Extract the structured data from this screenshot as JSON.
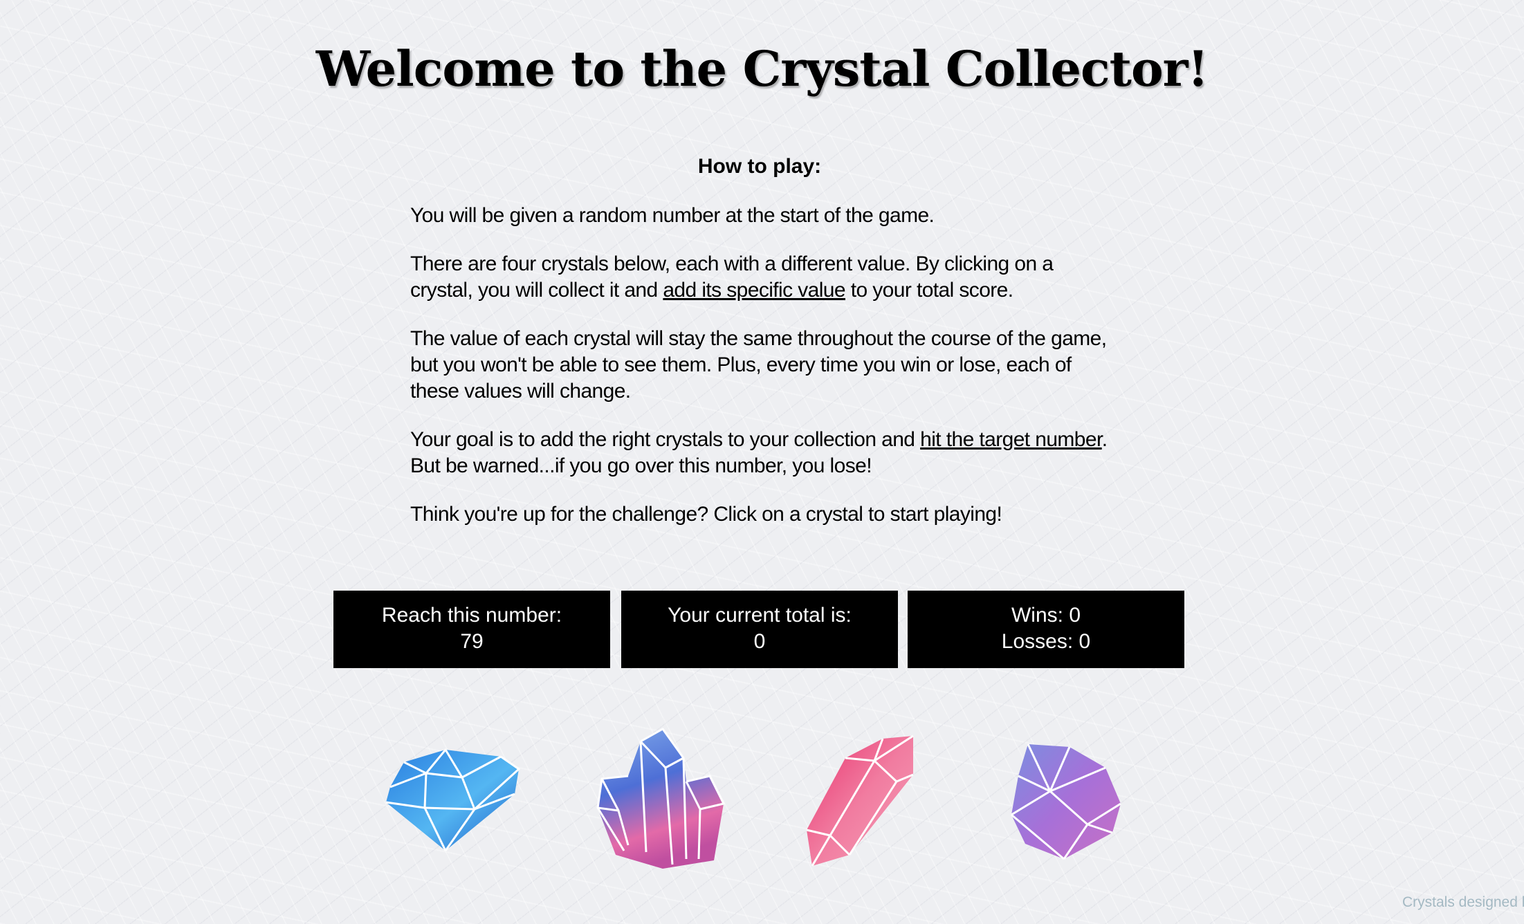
{
  "title": "Welcome to the Crystal Collector!",
  "instructions": {
    "heading": "How to play:",
    "p1": "You will be given a random number at the start of the game.",
    "p2_a": "There are four crystals below, each with a different value. By clicking on a crystal, you will collect it and ",
    "p2_link": "add its specific value",
    "p2_b": " to your total score.",
    "p3": "The value of each crystal will stay the same throughout the course of the game, but you won't be able to see them. Plus, every time you win or lose, each of these values will change.",
    "p4_a": "Your goal is to add the right crystals to your collection and ",
    "p4_link": "hit the target number",
    "p4_b": ". But be warned...if you go over this number, you lose!",
    "p5": "Think you're up for the challenge? Click on a crystal to start playing!"
  },
  "stats": {
    "target_label": "Reach this number:",
    "target_value": "79",
    "total_label": "Your current total is:",
    "total_value": "0",
    "wins_label": "Wins:",
    "wins_value": "0",
    "losses_label": "Losses:",
    "losses_value": "0"
  },
  "crystals": [
    {
      "name": "blue-diamond-crystal",
      "color": "#3d8fe0"
    },
    {
      "name": "blue-cluster-crystal",
      "color": "#6f8ee0"
    },
    {
      "name": "pink-shard-crystal",
      "color": "#ea5a86"
    },
    {
      "name": "purple-geode-crystal",
      "color": "#9b6fd6"
    }
  ],
  "credit": "Crystals designed b"
}
